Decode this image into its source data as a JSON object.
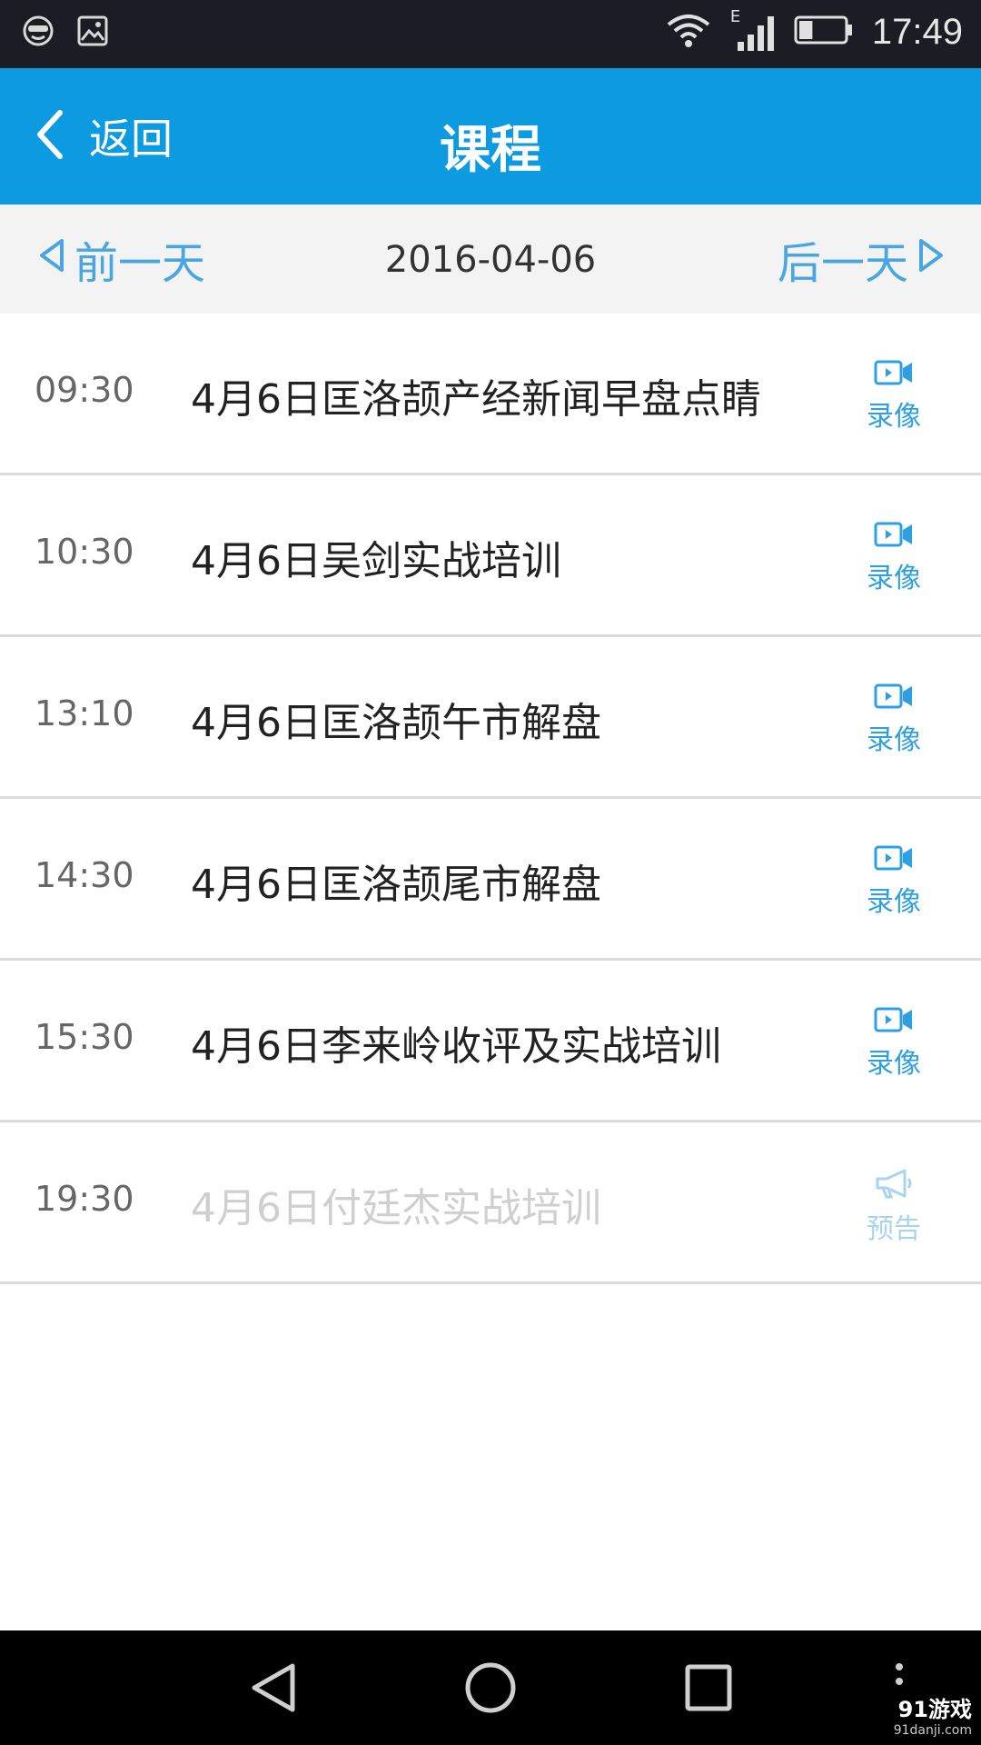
{
  "status_bar": {
    "time": "17:49",
    "network_type": "E",
    "battery_level": 0.3,
    "icons": [
      "smiley-mask-icon",
      "image-icon",
      "wifi-icon",
      "signal-icon",
      "battery-icon"
    ]
  },
  "header": {
    "back_label": "返回",
    "title": "课程"
  },
  "date_nav": {
    "prev_label": "前一天",
    "date": "2016-04-06",
    "next_label": "后一天"
  },
  "courses": [
    {
      "time": "09:30",
      "title": "4月6日匡洛颉产经新闻早盘点睛",
      "action": "录像",
      "status": "recorded"
    },
    {
      "time": "10:30",
      "title": "4月6日吴剑实战培训",
      "action": "录像",
      "status": "recorded"
    },
    {
      "time": "13:10",
      "title": "4月6日匡洛颉午市解盘",
      "action": "录像",
      "status": "recorded"
    },
    {
      "time": "14:30",
      "title": "4月6日匡洛颉尾市解盘",
      "action": "录像",
      "status": "recorded"
    },
    {
      "time": "15:30",
      "title": "4月6日李来岭收评及实战培训",
      "action": "录像",
      "status": "recorded"
    },
    {
      "time": "19:30",
      "title": "4月6日付廷杰实战培训",
      "action": "预告",
      "status": "upcoming"
    }
  ],
  "watermark": {
    "main": "91游戏",
    "sub": "91danji.com"
  },
  "colors": {
    "header_bg": "#0c9be0",
    "accent": "#2e9fe0",
    "date_bar_bg": "#f3f3f3",
    "upcoming_text": "#cfcfcf"
  }
}
